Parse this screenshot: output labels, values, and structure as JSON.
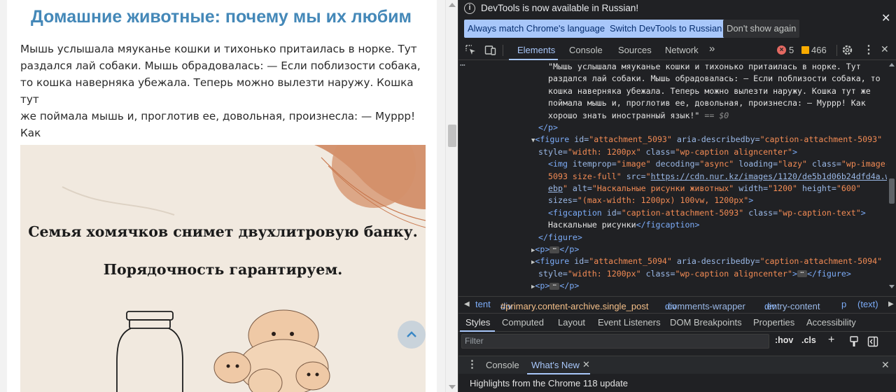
{
  "page": {
    "title": "Домашние животные: почему мы их любим",
    "paragraph_lines": [
      "Мышь услышала мяуканье кошки и тихонько притаилась в норке. Тут",
      "раздался лай собаки. Мышь обрадовалась: — Если поблизости собака,",
      "то кошка наверняка убежала. Теперь можно вылезти наружу. Кошка тут",
      "же поймала мышь и, проглотив ее, довольная, произнесла: — Муррр! Как",
      "хорошо знать иностранный язык!"
    ],
    "image_text_1": "Семья хомячков снимет двухлитровую банку.",
    "image_text_2": "Порядочность гарантируем."
  },
  "devtools": {
    "infobar": {
      "message": "DevTools is now available in Russian!",
      "btn_match": "Always match Chrome's language",
      "btn_switch": "Switch DevTools to Russian",
      "btn_dismiss": "Don't show again"
    },
    "tabs": [
      "Elements",
      "Console",
      "Sources",
      "Network"
    ],
    "errors_count": "5",
    "warnings_count": "466",
    "code": {
      "text_lines": [
        "\"Мышь услышала мяуканье кошки и тихонько притаилась в норке. Тут",
        "раздался лай собаки. Мышь обрадовалась: — Если поблизости собака, то",
        "кошка наверняка убежала. Теперь можно вылезти наружу. Кошка тут же",
        "поймала мышь и, проглотив ее, довольная, произнесла: — Муррр! Как",
        "хорошо знать иностранный язык!\""
      ],
      "eq_dollar": "== $0",
      "p_close": "</p>",
      "fig1_open_a": "<figure",
      "fig1_id_attr": "id=",
      "fig1_id_val": "\"attachment_5093\"",
      "fig1_aria_attr": "aria-describedby=",
      "fig1_aria_val": "\"caption-attachment-5093\"",
      "fig1_style_attr": "style=",
      "fig1_style_val": "\"width: 1200px\"",
      "fig1_class_attr": "class=",
      "fig1_class_val": "\"wp-caption aligncenter\"",
      "fig1_gt": ">",
      "img_open": "<img",
      "img_itemprop": "itemprop=",
      "img_itemprop_val": "\"image\"",
      "img_decoding": "decoding=",
      "img_decoding_val": "\"async\"",
      "img_loading": "loading=",
      "img_loading_val": "\"lazy\"",
      "img_class": "class=",
      "img_class_val_a": "\"wp-image-",
      "img_class_val_b": "5093 size-full\"",
      "img_src": "src=",
      "img_src_val_a": "\"",
      "img_src_link_a": "https://cdn.nur.kz/images/1120/de5b1d06b24dfd4a.w",
      "img_src_link_b": "ebp",
      "img_src_val_b": "\"",
      "img_alt": "alt=",
      "img_alt_val": "\"Наскальные рисунки животных\"",
      "img_width": "width=",
      "img_width_val": "\"1200\"",
      "img_height": "height=",
      "img_height_val": "\"600\"",
      "img_sizes": "sizes=",
      "img_sizes_val": "\"(max-width: 1200px) 100vw, 1200px\"",
      "img_gt": ">",
      "figcap_open": "<figcaption",
      "figcap_id": "id=",
      "figcap_id_val": "\"caption-attachment-5093\"",
      "figcap_class": "class=",
      "figcap_class_val": "\"wp-caption-text\"",
      "figcap_gt": ">",
      "figcap_text": "Наскальные рисунки",
      "figcap_close": "</figcaption>",
      "fig_close": "</figure>",
      "p_open": "<p>",
      "p_close2": "</p>",
      "fig2_open": "<figure",
      "fig2_id_attr": "id=",
      "fig2_id_val": "\"attachment_5094\"",
      "fig2_aria_attr": "aria-describedby=",
      "fig2_aria_val": "\"caption-attachment-5094\"",
      "fig2_style_attr": "style=",
      "fig2_style_val": "\"width: 1200px\"",
      "fig2_class_attr": "class=",
      "fig2_class_val": "\"wp-caption aligncenter\"",
      "fig2_gt": ">",
      "fig2_close": "</figure>",
      "p_open3": "<p>",
      "p_close3": "</p>",
      "ellipsis": "⋯"
    },
    "breadcrumbs": {
      "b0": "tent",
      "b1_tag": "div",
      "b1_rest": "#primary.content-archive.single_post",
      "b2_tag": "div",
      "b2_rest": ".comments-wrapper",
      "b3_tag": "div",
      "b3_rest": ".entry-content",
      "b4": "p",
      "b5": "(text)"
    },
    "subtabs": [
      "Styles",
      "Computed",
      "Layout",
      "Event Listeners",
      "DOM Breakpoints",
      "Properties",
      "Accessibility"
    ],
    "filter_placeholder": "Filter",
    "hov": ":hov",
    "cls": ".cls",
    "drawer": {
      "console": "Console",
      "whats_new": "What's New",
      "headline": "Highlights from the Chrome 118 update"
    }
  },
  "colors": {
    "title_blue": "#4488b8",
    "devtools_bg": "#202124",
    "accent": "#a8c7fa",
    "attr_value": "#f28b54",
    "tag": "#7cacf8"
  }
}
